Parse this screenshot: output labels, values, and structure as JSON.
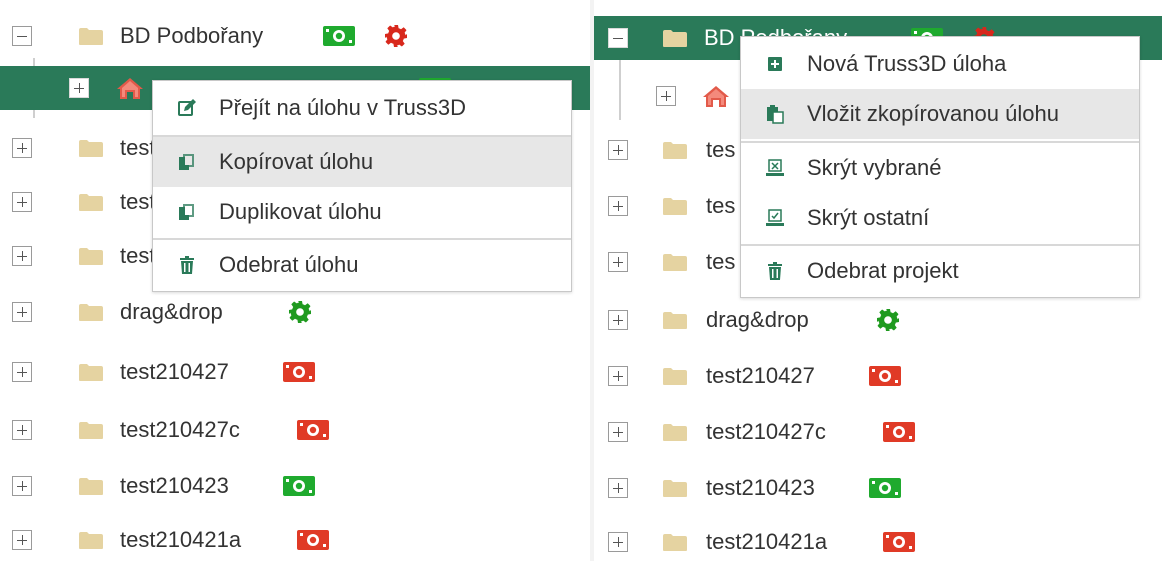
{
  "colors": {
    "selected_row": "#2a7a59",
    "cash_green": "#1faa2e",
    "cash_red": "#e03a26",
    "gear_red": "#d8281c",
    "gear_green": "#1f9a1f",
    "folder": "#e5d3a1"
  },
  "left": {
    "tree": [
      {
        "label": "BD Podbořany",
        "expanded": true,
        "badges": [
          "cash-green",
          "gear-red"
        ]
      },
      {
        "label": "",
        "selected": true,
        "icon": "house-icon",
        "badges": [
          "cash-green"
        ]
      },
      {
        "label": "test"
      },
      {
        "label": "test"
      },
      {
        "label": "test"
      },
      {
        "label": "drag&drop",
        "badges": [
          "gear-green"
        ]
      },
      {
        "label": "test210427",
        "badges": [
          "cash-red"
        ]
      },
      {
        "label": "test210427c",
        "badges": [
          "cash-red"
        ]
      },
      {
        "label": "test210423",
        "badges": [
          "cash-green"
        ]
      },
      {
        "label": "test210421a",
        "badges": [
          "cash-red"
        ]
      }
    ],
    "menu": [
      {
        "label": "Přejít na úlohu v Truss3D",
        "icon": "edit-icon"
      },
      {
        "label": "Kopírovat úlohu",
        "icon": "copy-icon"
      },
      {
        "label": "Duplikovat úlohu",
        "icon": "duplicate-icon"
      },
      {
        "label": "Odebrat úlohu",
        "icon": "trash-icon"
      }
    ]
  },
  "right": {
    "tree": [
      {
        "label": "BD Podbořany",
        "expanded": true,
        "selected": true,
        "badges": [
          "cash-green",
          "gear-red"
        ]
      },
      {
        "label": "",
        "icon": "house-icon"
      },
      {
        "label": "tes"
      },
      {
        "label": "tes"
      },
      {
        "label": "tes"
      },
      {
        "label": "drag&drop",
        "badges": [
          "gear-green"
        ]
      },
      {
        "label": "test210427",
        "badges": [
          "cash-red"
        ]
      },
      {
        "label": "test210427c",
        "badges": [
          "cash-red"
        ]
      },
      {
        "label": "test210423",
        "badges": [
          "cash-green"
        ]
      },
      {
        "label": "test210421a",
        "badges": [
          "cash-red"
        ]
      }
    ],
    "menu": [
      {
        "label": "Nová Truss3D úloha",
        "icon": "plus-icon"
      },
      {
        "label": "Vložit zkopírovanou úlohu",
        "icon": "paste-icon"
      },
      {
        "label": "Skrýt vybrané",
        "icon": "hide-selected-icon"
      },
      {
        "label": "Skrýt ostatní",
        "icon": "hide-others-icon"
      },
      {
        "label": "Odebrat projekt",
        "icon": "trash-icon"
      }
    ]
  }
}
